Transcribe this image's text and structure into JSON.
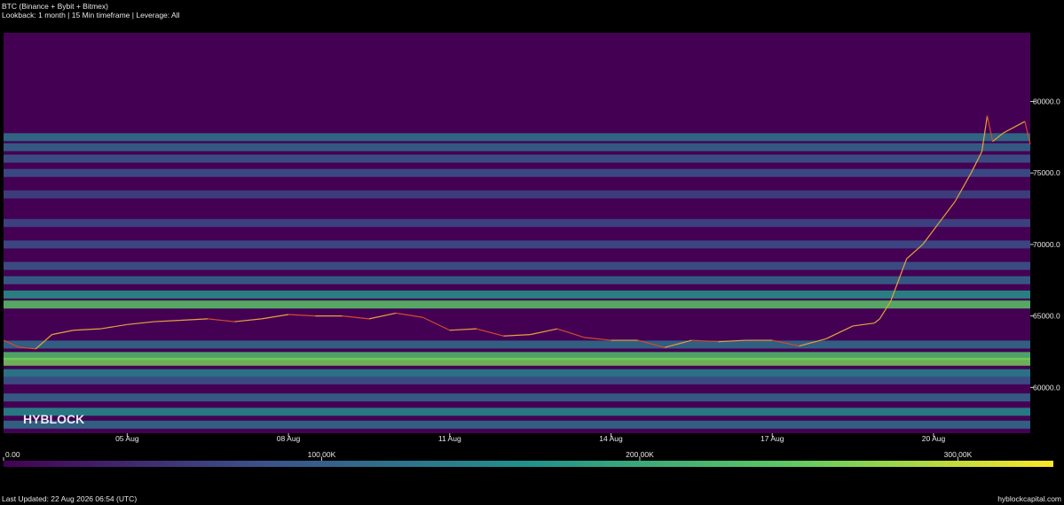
{
  "header": {
    "title": "BTC (Binance + Bybit + Bitmex)",
    "subtitle": "Lookback: 1 month | 15 Min timeframe | Leverage: All"
  },
  "footer": {
    "last_updated": "Last Updated: 22 Aug 2026 06:54 (UTC)",
    "site": "hyblockcapital.com"
  },
  "watermark": "HYBLOCK",
  "colors": {
    "background": "#000000",
    "price_line_up": "#e8a23a",
    "price_line_down": "#d7482d",
    "colormap": [
      "#440154",
      "#3b528b",
      "#21918c",
      "#5ec962",
      "#fde725"
    ]
  },
  "chart_data": {
    "type": "heatmap",
    "title": "",
    "xlabel": "",
    "ylabel": "",
    "x_ticks": [
      "05 Aug",
      "08 Aug",
      "11 Aug",
      "14 Aug",
      "17 Aug",
      "20 Aug"
    ],
    "x_range_days": [
      2.7,
      21.8
    ],
    "y_ticks": [
      60000.0,
      65000.0,
      70000.0,
      75000.0,
      80000.0
    ],
    "y_tick_labels": [
      "60000.0",
      "65000.0",
      "70000.0",
      "75000.0",
      "80000.0"
    ],
    "ylim": [
      56800,
      84800
    ],
    "colorbar": {
      "min": 0,
      "max": 330000,
      "ticks": [
        0,
        100000,
        200000,
        300000
      ],
      "tick_labels": [
        "0.00",
        "100.00K",
        "200.00K",
        "300.00K"
      ]
    },
    "liquidation_bands": [
      {
        "price": 77500,
        "value": 130000
      },
      {
        "price": 76800,
        "value": 110000
      },
      {
        "price": 76000,
        "value": 90000
      },
      {
        "price": 75000,
        "value": 85000
      },
      {
        "price": 73500,
        "value": 70000
      },
      {
        "price": 71500,
        "value": 75000
      },
      {
        "price": 70000,
        "value": 80000
      },
      {
        "price": 68500,
        "value": 90000
      },
      {
        "price": 67500,
        "value": 110000
      },
      {
        "price": 66500,
        "value": 170000
      },
      {
        "price": 65800,
        "value": 240000
      },
      {
        "price": 63000,
        "value": 120000
      },
      {
        "price": 62200,
        "value": 230000
      },
      {
        "price": 61800,
        "value": 260000
      },
      {
        "price": 61000,
        "value": 150000
      },
      {
        "price": 60500,
        "value": 90000
      },
      {
        "price": 59300,
        "value": 110000
      },
      {
        "price": 58300,
        "value": 160000
      },
      {
        "price": 57400,
        "value": 120000
      }
    ],
    "price_series": {
      "name": "BTC",
      "x_days": [
        2.7,
        3.0,
        3.3,
        3.6,
        4.0,
        4.5,
        5.0,
        5.5,
        6.0,
        6.5,
        7.0,
        7.5,
        8.0,
        8.5,
        9.0,
        9.5,
        10.0,
        10.5,
        11.0,
        11.5,
        12.0,
        12.5,
        13.0,
        13.5,
        14.0,
        14.5,
        15.0,
        15.5,
        16.0,
        16.5,
        17.0,
        17.5,
        18.0,
        18.5,
        18.9,
        19.0,
        19.2,
        19.5,
        19.8,
        20.1,
        20.4,
        20.7,
        20.9,
        21.0,
        21.1,
        21.3,
        21.5,
        21.7,
        21.8
      ],
      "y": [
        63300,
        62800,
        62700,
        63700,
        64000,
        64100,
        64400,
        64600,
        64700,
        64800,
        64600,
        64800,
        65100,
        65000,
        65000,
        64800,
        65200,
        64900,
        64000,
        64100,
        63600,
        63700,
        64100,
        63500,
        63300,
        63300,
        62800,
        63300,
        63200,
        63300,
        63300,
        62900,
        63400,
        64300,
        64500,
        64800,
        66000,
        69000,
        70000,
        71500,
        73000,
        75000,
        76500,
        79000,
        77200,
        77800,
        78200,
        78600,
        77000
      ]
    }
  }
}
